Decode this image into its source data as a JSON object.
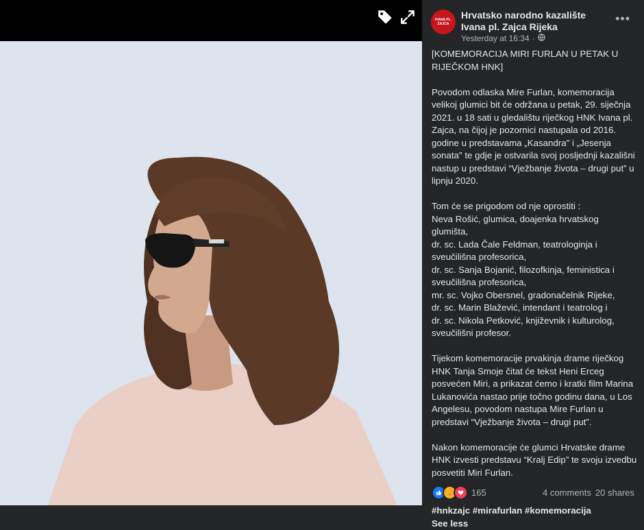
{
  "post": {
    "page_name": "Hrvatsko narodno kazalište Ivana pl. Zajca Rijeka",
    "avatar_text": "IVANA PL. ZAJCA",
    "timestamp": "Yesterday at 16:34",
    "separator": "·",
    "paragraphs": [
      "[KOMEMORACIJA MIRI FURLAN U PETAK U RIJEČKOM HNK]",
      "Povodom odlaska Mire Furlan, komemoracija velikoj glumici bit će održana u petak, 29. siječnja 2021. u 18 sati u gledalištu riječkog HNK Ivana pl. Zajca, na čijoj je pozornici nastupala od 2016. godine u predstavama „Kasandra\" i „Jesenja sonata\" te gdje je ostvarila svoj posljednji kazališni nastup u predstavi “Vježbanje života – drugi put” u lipnju 2020.",
      "Tom će se prigodom od nje oprostiti :\nNeva Rošić, glumica, doajenka hrvatskog glumišta,\ndr. sc. Lada Čale Feldman, teatrologinja i sveučilišna profesorica,\ndr. sc. Sanja Bojanić, filozofkinja, feministica i sveučilišna profesorica,\nmr. sc. Vojko Obersnel, gradonačelnik Rijeke,\ndr. sc. Marin Blažević, intendant i teatrolog i\ndr. sc. Nikola Petković, književnik i kulturolog, sveučilišni profesor.",
      "Tijekom komemoracije prvakinja drame riječkog HNK Tanja Smoje čitat će tekst Heni Erceg posvećen Miri, a prikazat ćemo i kratki film Marina Lukanovića nastao prije točno godinu dana, u Los Angelesu, povodom nastupa Mire Furlan u predstavi “Vježbanje života – drugi put”.",
      "Nakon komemoracije će glumci Hrvatske drame HNK izvesti predstavu “Kralj Edip” te svoju izvedbu posvetiti Miri Furlan."
    ],
    "hashtags": "#hnkzajc #mirafurlan #komemoracija",
    "see_less": "See less",
    "reaction_count": "165",
    "comments": "4 comments",
    "shares": "20 shares"
  },
  "icons": {
    "tag": "tag-icon",
    "expand": "expand-icon",
    "globe": "globe-icon",
    "more": "more-options-icon",
    "like": "like-reaction-icon",
    "care": "care-reaction-icon",
    "love": "love-reaction-icon"
  },
  "colors": {
    "panel_bg": "#242526",
    "photo_bg": "#dde4ee",
    "like_blue": "#1877f2",
    "love_red": "#f33e58",
    "care_yellow": "#f7b125"
  }
}
